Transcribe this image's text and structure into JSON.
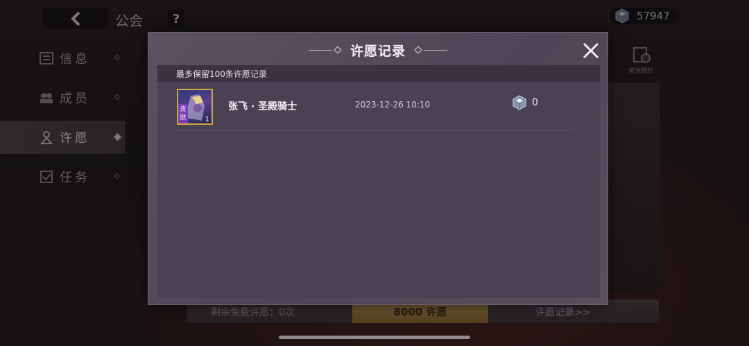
{
  "header": {
    "title": "公会",
    "help_label": "?",
    "currency_value": "57947"
  },
  "sidebar": {
    "items": [
      {
        "label": "信息",
        "icon": "info-icon"
      },
      {
        "label": "成员",
        "icon": "members-icon"
      },
      {
        "label": "许愿",
        "icon": "wish-icon",
        "active": true
      },
      {
        "label": "任务",
        "icon": "task-icon"
      }
    ]
  },
  "right_panel": {
    "prize_pool_label": "奖池预约"
  },
  "footer": {
    "free_wish_label": "剩余免费许愿：0次",
    "wish_button_label": "8000 许愿",
    "records_link_label": "许愿记录>>"
  },
  "modal": {
    "title": "许愿记录",
    "note": "最多保留100条许愿记录",
    "records": [
      {
        "name": "张飞 · 圣殿骑士",
        "time": "2023-12-26 10:10",
        "cost": "0",
        "skin_tag": "皮肤",
        "count": "1",
        "icon": "zhangfei-skin-portrait"
      }
    ]
  },
  "colors": {
    "modal_bg": "#4e4656",
    "note_bar_bg": "#3a3340",
    "icon_border_gold": "#d6a740",
    "skin_tag_purple": "#7a3fb0"
  }
}
